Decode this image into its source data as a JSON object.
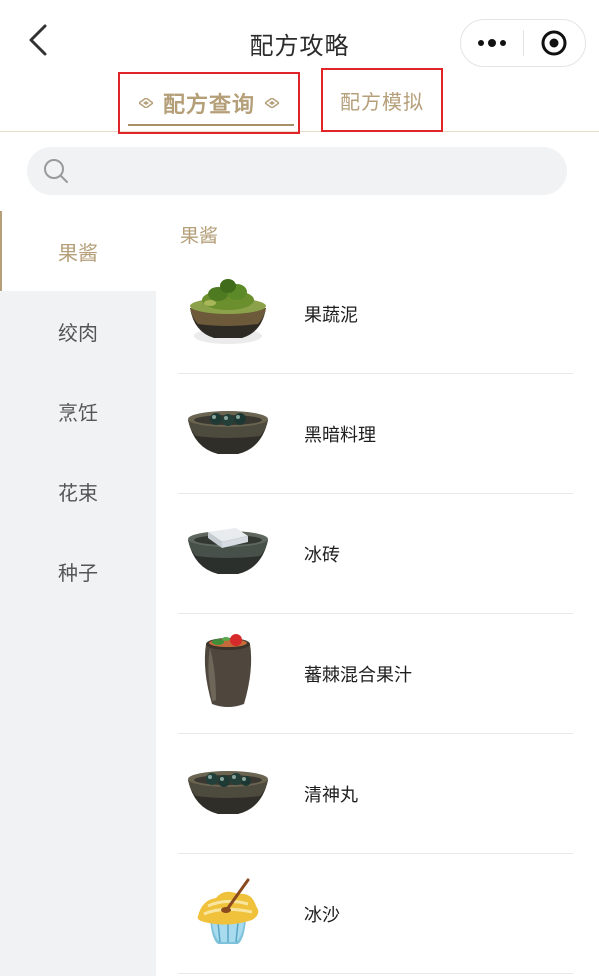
{
  "nav": {
    "title": "配方攻略"
  },
  "tabs": {
    "active": "配方查询",
    "inactive": "配方模拟"
  },
  "search": {
    "placeholder": "",
    "value": ""
  },
  "sidebar": {
    "items": [
      {
        "label": "果酱"
      },
      {
        "label": "绞肉"
      },
      {
        "label": "烹饪"
      },
      {
        "label": "花束"
      },
      {
        "label": "种子"
      }
    ]
  },
  "main": {
    "section_title": "果酱",
    "items": [
      {
        "name": "果蔬泥",
        "icon": "vegetable-puree-bowl-icon"
      },
      {
        "name": "黑暗料理",
        "icon": "dark-bowl-icon"
      },
      {
        "name": "冰砖",
        "icon": "ice-brick-bowl-icon"
      },
      {
        "name": "蕃棘混合果汁",
        "icon": "juice-cup-icon"
      },
      {
        "name": "清神丸",
        "icon": "pill-bowl-icon"
      },
      {
        "name": "冰沙",
        "icon": "smoothie-cup-icon"
      }
    ]
  },
  "colors": {
    "accent": "#b59f79",
    "highlight_box": "#e0242a",
    "sidebar_bg": "#f1f2f4"
  }
}
